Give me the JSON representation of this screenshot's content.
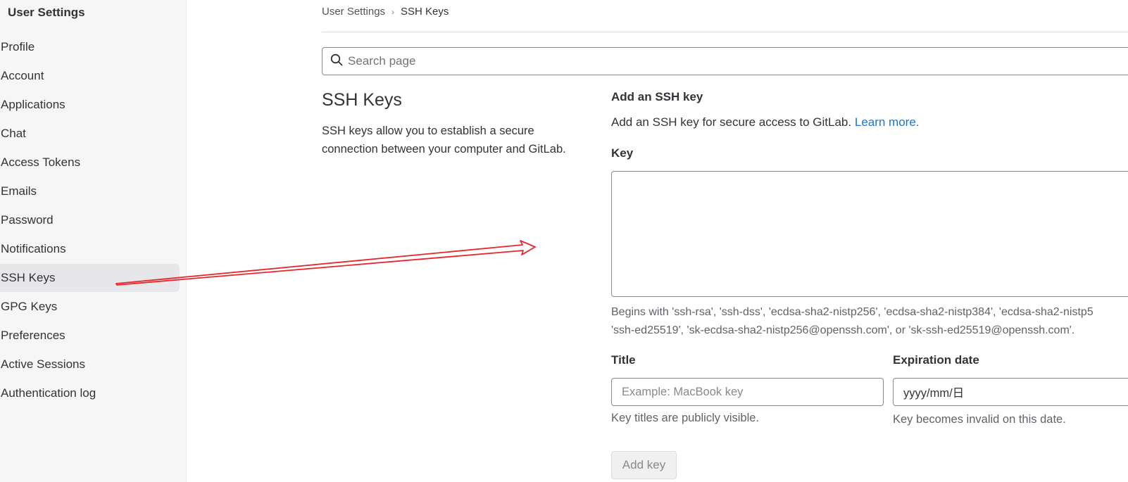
{
  "sidebar": {
    "header": "User Settings",
    "items": [
      {
        "label": "Profile"
      },
      {
        "label": "Account"
      },
      {
        "label": "Applications"
      },
      {
        "label": "Chat"
      },
      {
        "label": "Access Tokens"
      },
      {
        "label": "Emails"
      },
      {
        "label": "Password"
      },
      {
        "label": "Notifications"
      },
      {
        "label": "SSH Keys",
        "active": true
      },
      {
        "label": "GPG Keys"
      },
      {
        "label": "Preferences"
      },
      {
        "label": "Active Sessions"
      },
      {
        "label": "Authentication log"
      }
    ]
  },
  "breadcrumb": {
    "parent": "User Settings",
    "separator": "›",
    "current": "SSH Keys"
  },
  "search": {
    "placeholder": "Search page"
  },
  "section": {
    "title": "SSH Keys",
    "description": "SSH keys allow you to establish a secure connection between your computer and GitLab."
  },
  "add_key": {
    "title": "Add an SSH key",
    "description": "Add an SSH key for secure access to GitLab.",
    "learn_more": "Learn more.",
    "key_label": "Key",
    "key_value": "",
    "key_help_line1": "Begins with 'ssh-rsa', 'ssh-dss', 'ecdsa-sha2-nistp256', 'ecdsa-sha2-nistp384', 'ecdsa-sha2-nistp5",
    "key_help_line2": "'ssh-ed25519', 'sk-ecdsa-sha2-nistp256@openssh.com', or 'sk-ssh-ed25519@openssh.com'.",
    "title_label": "Title",
    "title_placeholder": "Example: MacBook key",
    "title_help": "Key titles are publicly visible.",
    "expiration_label": "Expiration date",
    "expiration_value": "yyyy/mm/日",
    "expiration_help": "Key becomes invalid on this date.",
    "submit_label": "Add key"
  },
  "colors": {
    "link": "#1f75cb",
    "annotation_arrow": "#e8262d",
    "active_item_bg": "#e7e7ea"
  }
}
